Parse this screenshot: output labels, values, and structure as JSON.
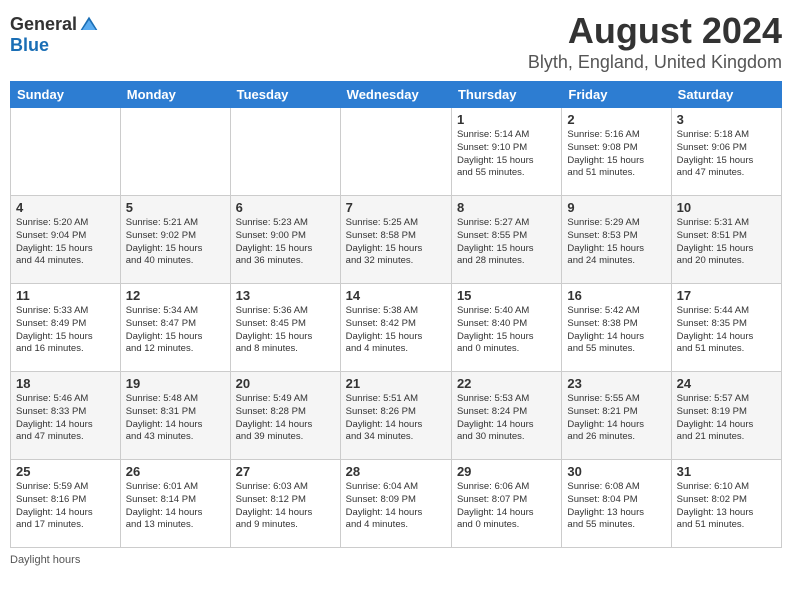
{
  "header": {
    "logo_general": "General",
    "logo_blue": "Blue",
    "month_title": "August 2024",
    "location": "Blyth, England, United Kingdom"
  },
  "days_of_week": [
    "Sunday",
    "Monday",
    "Tuesday",
    "Wednesday",
    "Thursday",
    "Friday",
    "Saturday"
  ],
  "footer": {
    "daylight_hours": "Daylight hours"
  },
  "weeks": [
    [
      {
        "day": "",
        "info": ""
      },
      {
        "day": "",
        "info": ""
      },
      {
        "day": "",
        "info": ""
      },
      {
        "day": "",
        "info": ""
      },
      {
        "day": "1",
        "info": "Sunrise: 5:14 AM\nSunset: 9:10 PM\nDaylight: 15 hours\nand 55 minutes."
      },
      {
        "day": "2",
        "info": "Sunrise: 5:16 AM\nSunset: 9:08 PM\nDaylight: 15 hours\nand 51 minutes."
      },
      {
        "day": "3",
        "info": "Sunrise: 5:18 AM\nSunset: 9:06 PM\nDaylight: 15 hours\nand 47 minutes."
      }
    ],
    [
      {
        "day": "4",
        "info": "Sunrise: 5:20 AM\nSunset: 9:04 PM\nDaylight: 15 hours\nand 44 minutes."
      },
      {
        "day": "5",
        "info": "Sunrise: 5:21 AM\nSunset: 9:02 PM\nDaylight: 15 hours\nand 40 minutes."
      },
      {
        "day": "6",
        "info": "Sunrise: 5:23 AM\nSunset: 9:00 PM\nDaylight: 15 hours\nand 36 minutes."
      },
      {
        "day": "7",
        "info": "Sunrise: 5:25 AM\nSunset: 8:58 PM\nDaylight: 15 hours\nand 32 minutes."
      },
      {
        "day": "8",
        "info": "Sunrise: 5:27 AM\nSunset: 8:55 PM\nDaylight: 15 hours\nand 28 minutes."
      },
      {
        "day": "9",
        "info": "Sunrise: 5:29 AM\nSunset: 8:53 PM\nDaylight: 15 hours\nand 24 minutes."
      },
      {
        "day": "10",
        "info": "Sunrise: 5:31 AM\nSunset: 8:51 PM\nDaylight: 15 hours\nand 20 minutes."
      }
    ],
    [
      {
        "day": "11",
        "info": "Sunrise: 5:33 AM\nSunset: 8:49 PM\nDaylight: 15 hours\nand 16 minutes."
      },
      {
        "day": "12",
        "info": "Sunrise: 5:34 AM\nSunset: 8:47 PM\nDaylight: 15 hours\nand 12 minutes."
      },
      {
        "day": "13",
        "info": "Sunrise: 5:36 AM\nSunset: 8:45 PM\nDaylight: 15 hours\nand 8 minutes."
      },
      {
        "day": "14",
        "info": "Sunrise: 5:38 AM\nSunset: 8:42 PM\nDaylight: 15 hours\nand 4 minutes."
      },
      {
        "day": "15",
        "info": "Sunrise: 5:40 AM\nSunset: 8:40 PM\nDaylight: 15 hours\nand 0 minutes."
      },
      {
        "day": "16",
        "info": "Sunrise: 5:42 AM\nSunset: 8:38 PM\nDaylight: 14 hours\nand 55 minutes."
      },
      {
        "day": "17",
        "info": "Sunrise: 5:44 AM\nSunset: 8:35 PM\nDaylight: 14 hours\nand 51 minutes."
      }
    ],
    [
      {
        "day": "18",
        "info": "Sunrise: 5:46 AM\nSunset: 8:33 PM\nDaylight: 14 hours\nand 47 minutes."
      },
      {
        "day": "19",
        "info": "Sunrise: 5:48 AM\nSunset: 8:31 PM\nDaylight: 14 hours\nand 43 minutes."
      },
      {
        "day": "20",
        "info": "Sunrise: 5:49 AM\nSunset: 8:28 PM\nDaylight: 14 hours\nand 39 minutes."
      },
      {
        "day": "21",
        "info": "Sunrise: 5:51 AM\nSunset: 8:26 PM\nDaylight: 14 hours\nand 34 minutes."
      },
      {
        "day": "22",
        "info": "Sunrise: 5:53 AM\nSunset: 8:24 PM\nDaylight: 14 hours\nand 30 minutes."
      },
      {
        "day": "23",
        "info": "Sunrise: 5:55 AM\nSunset: 8:21 PM\nDaylight: 14 hours\nand 26 minutes."
      },
      {
        "day": "24",
        "info": "Sunrise: 5:57 AM\nSunset: 8:19 PM\nDaylight: 14 hours\nand 21 minutes."
      }
    ],
    [
      {
        "day": "25",
        "info": "Sunrise: 5:59 AM\nSunset: 8:16 PM\nDaylight: 14 hours\nand 17 minutes."
      },
      {
        "day": "26",
        "info": "Sunrise: 6:01 AM\nSunset: 8:14 PM\nDaylight: 14 hours\nand 13 minutes."
      },
      {
        "day": "27",
        "info": "Sunrise: 6:03 AM\nSunset: 8:12 PM\nDaylight: 14 hours\nand 9 minutes."
      },
      {
        "day": "28",
        "info": "Sunrise: 6:04 AM\nSunset: 8:09 PM\nDaylight: 14 hours\nand 4 minutes."
      },
      {
        "day": "29",
        "info": "Sunrise: 6:06 AM\nSunset: 8:07 PM\nDaylight: 14 hours\nand 0 minutes."
      },
      {
        "day": "30",
        "info": "Sunrise: 6:08 AM\nSunset: 8:04 PM\nDaylight: 13 hours\nand 55 minutes."
      },
      {
        "day": "31",
        "info": "Sunrise: 6:10 AM\nSunset: 8:02 PM\nDaylight: 13 hours\nand 51 minutes."
      }
    ]
  ]
}
